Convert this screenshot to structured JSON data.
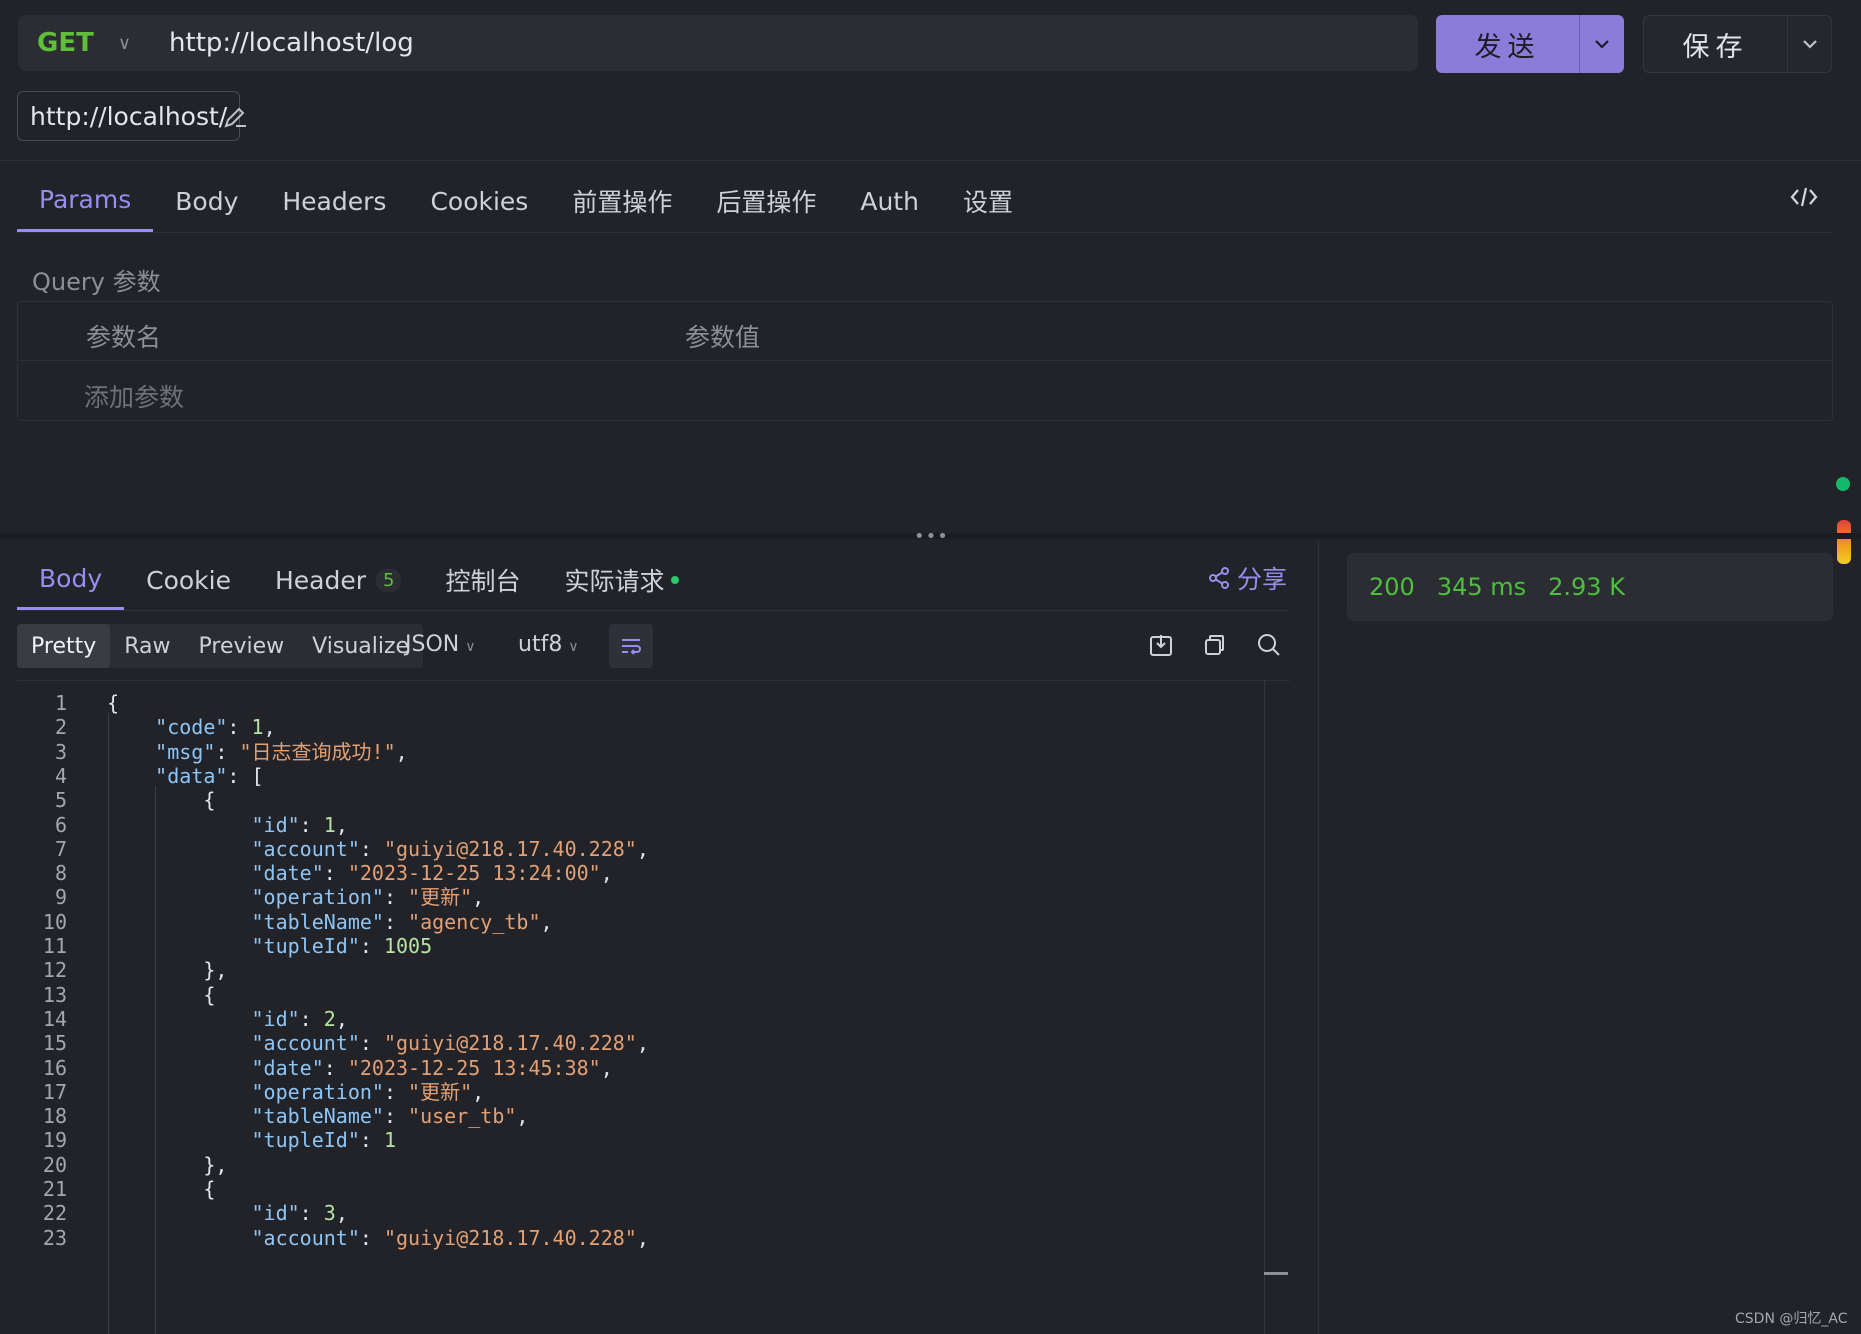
{
  "request": {
    "method": "GET",
    "url": "http://localhost/log",
    "base_url": "http://localhost/",
    "send_label": "发送",
    "save_label": "保存"
  },
  "request_tabs": [
    "Params",
    "Body",
    "Headers",
    "Cookies",
    "前置操作",
    "后置操作",
    "Auth",
    "设置"
  ],
  "active_request_tab": "Params",
  "query": {
    "section_label": "Query 参数",
    "col_name": "参数名",
    "col_value": "参数值",
    "add_placeholder": "添加参数"
  },
  "response_tabs": {
    "body": "Body",
    "cookie": "Cookie",
    "header": "Header",
    "header_count": "5",
    "console": "控制台",
    "actual_request": "实际请求",
    "share": "分享"
  },
  "view_modes": [
    "Pretty",
    "Raw",
    "Preview",
    "Visualize"
  ],
  "active_view_mode": "Pretty",
  "format": "JSON",
  "charset": "utf8",
  "status": {
    "code": "200",
    "time": "345 ms",
    "size": "2.93 K"
  },
  "code_lines": [
    [
      "{"
    ],
    [
      "    ",
      [
        "k",
        "\"code\""
      ],
      ": ",
      [
        "n",
        "1"
      ],
      ","
    ],
    [
      "    ",
      [
        "k",
        "\"msg\""
      ],
      ": ",
      [
        "s",
        "\"日志查询成功!\""
      ],
      ","
    ],
    [
      "    ",
      [
        "k",
        "\"data\""
      ],
      ": ["
    ],
    [
      "        {"
    ],
    [
      "            ",
      [
        "k",
        "\"id\""
      ],
      ": ",
      [
        "n",
        "1"
      ],
      ","
    ],
    [
      "            ",
      [
        "k",
        "\"account\""
      ],
      ": ",
      [
        "s",
        "\"guiyi@218.17.40.228\""
      ],
      ","
    ],
    [
      "            ",
      [
        "k",
        "\"date\""
      ],
      ": ",
      [
        "s",
        "\"2023-12-25 13:24:00\""
      ],
      ","
    ],
    [
      "            ",
      [
        "k",
        "\"operation\""
      ],
      ": ",
      [
        "s",
        "\"更新\""
      ],
      ","
    ],
    [
      "            ",
      [
        "k",
        "\"tableName\""
      ],
      ": ",
      [
        "s",
        "\"agency_tb\""
      ],
      ","
    ],
    [
      "            ",
      [
        "k",
        "\"tupleId\""
      ],
      ": ",
      [
        "n",
        "1005"
      ]
    ],
    [
      "        },"
    ],
    [
      "        {"
    ],
    [
      "            ",
      [
        "k",
        "\"id\""
      ],
      ": ",
      [
        "n",
        "2"
      ],
      ","
    ],
    [
      "            ",
      [
        "k",
        "\"account\""
      ],
      ": ",
      [
        "s",
        "\"guiyi@218.17.40.228\""
      ],
      ","
    ],
    [
      "            ",
      [
        "k",
        "\"date\""
      ],
      ": ",
      [
        "s",
        "\"2023-12-25 13:45:38\""
      ],
      ","
    ],
    [
      "            ",
      [
        "k",
        "\"operation\""
      ],
      ": ",
      [
        "s",
        "\"更新\""
      ],
      ","
    ],
    [
      "            ",
      [
        "k",
        "\"tableName\""
      ],
      ": ",
      [
        "s",
        "\"user_tb\""
      ],
      ","
    ],
    [
      "            ",
      [
        "k",
        "\"tupleId\""
      ],
      ": ",
      [
        "n",
        "1"
      ]
    ],
    [
      "        },"
    ],
    [
      "        {"
    ],
    [
      "            ",
      [
        "k",
        "\"id\""
      ],
      ": ",
      [
        "n",
        "3"
      ],
      ","
    ],
    [
      "            ",
      [
        "k",
        "\"account\""
      ],
      ": ",
      [
        "s",
        "\"guiyi@218.17.40.228\""
      ],
      ","
    ]
  ],
  "watermark": "CSDN @归忆_AC",
  "colors": {
    "accent": "#9b8cf0",
    "send_button": "#8a7cd8",
    "method_get": "#5fbf3a",
    "status_ok": "#4cbf3c"
  }
}
